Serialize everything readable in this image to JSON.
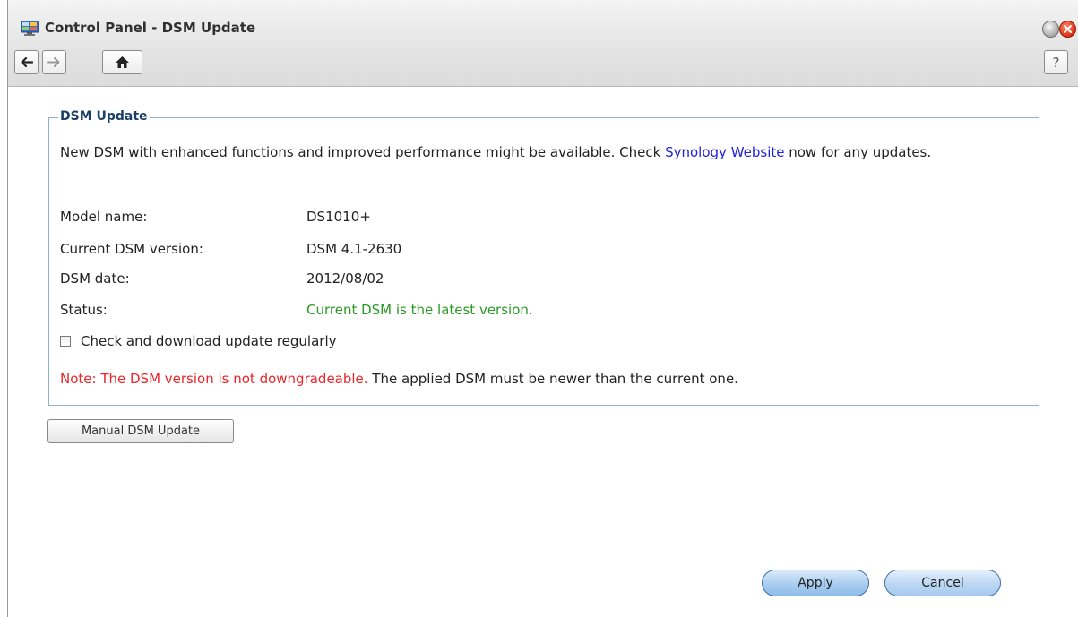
{
  "window": {
    "title": "Control Panel - DSM Update",
    "help_label": "?"
  },
  "section": {
    "legend": "DSM Update",
    "intro_before": "New DSM with enhanced functions and improved performance might be available. Check ",
    "intro_link": "Synology Website",
    "intro_after": " now for any updates.",
    "rows": [
      {
        "label": "Model name:",
        "value": "DS1010+"
      },
      {
        "label": "Current DSM version:",
        "value": "DSM 4.1-2630"
      },
      {
        "label": "DSM date:",
        "value": "2012/08/02"
      },
      {
        "label": "Status:",
        "value": "Current DSM is the latest version."
      }
    ],
    "checkbox_label": "Check and download update regularly",
    "checkbox_checked": false,
    "note_red": "Note: The DSM version is not downgradeable.",
    "note_rest": " The applied DSM must be newer than the current one."
  },
  "buttons": {
    "manual_update": "Manual DSM Update",
    "apply": "Apply",
    "cancel": "Cancel"
  },
  "colors": {
    "status_ok": "#2a9a24",
    "note_red": "#e8262a",
    "link": "#2323d8",
    "legend": "#1b3f66"
  }
}
